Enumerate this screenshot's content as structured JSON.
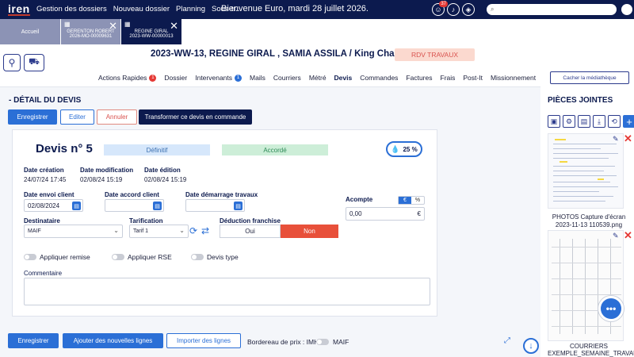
{
  "topbar": {
    "logo": "iren",
    "nav": [
      "Gestion des dossiers",
      "Nouveau dossier",
      "Planning",
      "Sous-tr..."
    ],
    "welcome": "Bienvenue Euro, mardi 28 juillet 2026.",
    "notif_count": "37",
    "search_placeholder": ""
  },
  "tabs": {
    "home": "Accueil",
    "tab2_line1": "GERENTON ROBERT",
    "tab2_line2": "2026-MO-00009631",
    "tab3_line1": "REGINE GIRAL",
    "tab3_line2": "2023-WW-00000013"
  },
  "header": {
    "title": "2023-WW-13, REGINE GIRAL , SAMIA ASSILA / King Charles",
    "rdv": "RDV TRAVAUX",
    "hide_media": "Cacher la médiathèque"
  },
  "subnav": {
    "items": [
      "Actions Rapides",
      "Dossier",
      "Intervenants",
      "Mails",
      "Courriers",
      "Métré",
      "Devis",
      "Commandes",
      "Factures",
      "Frais",
      "Post-It",
      "Missionnement"
    ],
    "actions_count": "1",
    "intervenants_count": "1"
  },
  "devis": {
    "section_title": "- DÉTAIL DU DEVIS",
    "buttons": {
      "save": "Enregistrer",
      "edit": "Editer",
      "cancel": "Annuler",
      "transform": "Transformer ce devis en commande"
    },
    "number": "Devis n° 5",
    "status1": "Définitif",
    "status2": "Accordé",
    "progress": "25 %",
    "labels": {
      "creation": "Date création",
      "modification": "Date modification",
      "edition": "Date édition",
      "envoi": "Date envoi client",
      "accord": "Date accord client",
      "demarrage": "Date démarrage travaux",
      "destinataire": "Destinataire",
      "tarification": "Tarification",
      "deduction": "Déduction franchise",
      "acompte": "Acompte",
      "commentaire": "Commentaire"
    },
    "values": {
      "creation": "24/07/24 17:45",
      "modification": "02/08/24 15:19",
      "edition": "02/08/24 15:19",
      "envoi": "02/08/2024",
      "accord": "",
      "demarrage": "",
      "destinataire": "MAIF",
      "tarification": "Tarif 1",
      "oui": "Oui",
      "non": "Non",
      "acompte": "0,00",
      "acompte_unit": "€",
      "unit_euro": "€",
      "unit_pct": "%"
    },
    "toggles": [
      "Appliquer remise",
      "Appliquer RSE",
      "Devis type"
    ]
  },
  "bottom": {
    "save": "Enregistrer",
    "add_lines": "Ajouter des nouvelles lignes",
    "import_lines": "Importer des lignes",
    "bordereau": "Bordereau de prix : IMH",
    "maif": "MAIF"
  },
  "attachments": {
    "title": "PIÈCES JOINTES",
    "file1": "PHOTOS Capture d'écran 2023-11-13 110539.png",
    "file2": "COURRIERS EXEMPLE_SEMAINE_TRAVAU..."
  },
  "colors": {
    "navy": "#0c1a4e",
    "primary": "#2b6fd6",
    "danger": "#e8503a",
    "success_bg": "#cdeed8",
    "info_bg": "#d6e7fb"
  }
}
